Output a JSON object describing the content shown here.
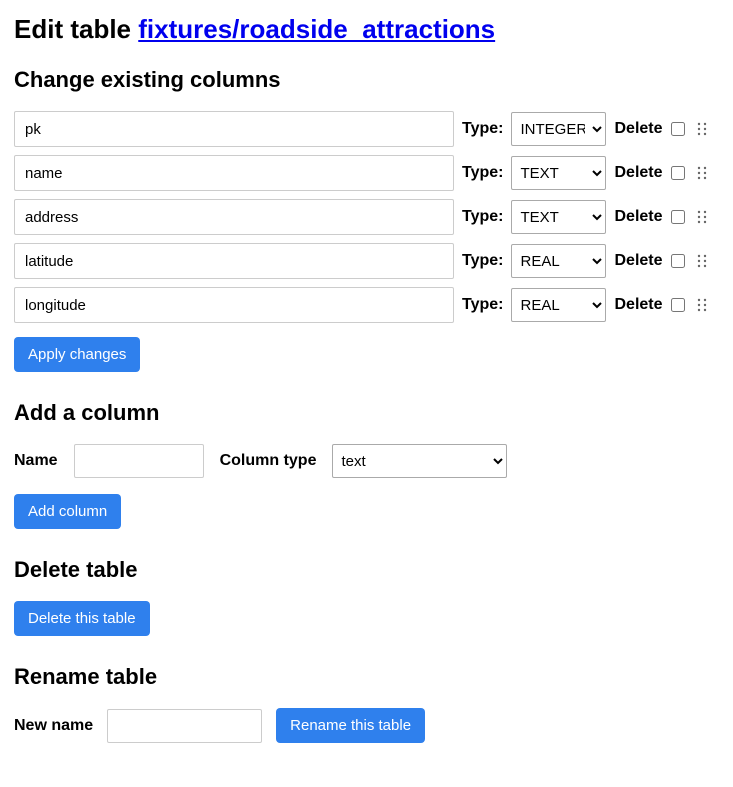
{
  "header": {
    "prefix": "Edit table ",
    "link_text": "fixtures/roadside_attractions"
  },
  "change_columns": {
    "heading": "Change existing columns",
    "type_label": "Type:",
    "delete_label": "Delete",
    "columns": [
      {
        "name": "pk",
        "type": "INTEGER"
      },
      {
        "name": "name",
        "type": "TEXT"
      },
      {
        "name": "address",
        "type": "TEXT"
      },
      {
        "name": "latitude",
        "type": "REAL"
      },
      {
        "name": "longitude",
        "type": "REAL"
      }
    ],
    "apply_button": "Apply changes"
  },
  "add_column": {
    "heading": "Add a column",
    "name_label": "Name",
    "type_label": "Column type",
    "type_value": "text",
    "button": "Add column"
  },
  "delete_table": {
    "heading": "Delete table",
    "button": "Delete this table"
  },
  "rename_table": {
    "heading": "Rename table",
    "name_label": "New name",
    "button": "Rename this table"
  }
}
